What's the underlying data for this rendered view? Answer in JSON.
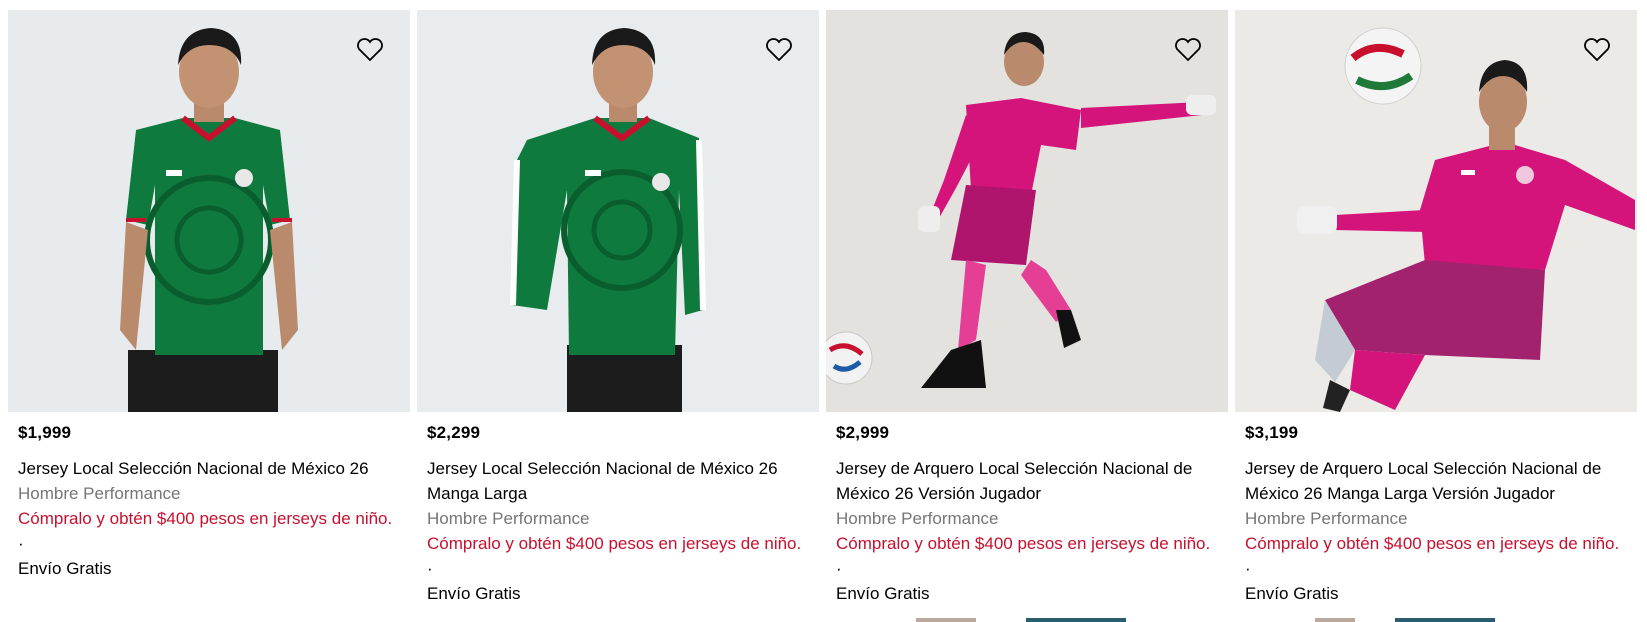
{
  "products": [
    {
      "price": "$1,999",
      "name": "Jersey Local Selección Nacional de México 26",
      "category": "Hombre Performance",
      "promo": "Cómpralo y obtén $400 pesos en jerseys de niño.",
      "separator": "·",
      "shipping": "Envío Gratis"
    },
    {
      "price": "$2,299",
      "name": "Jersey Local Selección Nacional de México 26 Manga Larga",
      "category": "Hombre Performance",
      "promo": "Cómpralo y obtén $400 pesos en jerseys de niño.",
      "separator": "·",
      "shipping": "Envío Gratis"
    },
    {
      "price": "$2,999",
      "name": "Jersey de Arquero Local Selección Nacional de México 26 Versión Jugador",
      "category": "Hombre Performance",
      "promo": "Cómpralo y obtén $400 pesos en jerseys de niño.",
      "separator": "·",
      "shipping": "Envío Gratis"
    },
    {
      "price": "$3,199",
      "name": "Jersey de Arquero Local Selección Nacional de México 26 Manga Larga Versión Jugador",
      "category": "Hombre Performance",
      "promo": "Cómpralo y obtén $400 pesos en jerseys de niño.",
      "separator": "·",
      "shipping": "Envío Gratis"
    }
  ],
  "icons": {
    "wishlist": "heart-outline-icon"
  },
  "colors": {
    "promo": "#c8102e",
    "category": "#767677",
    "image_bg": "#e8ecee",
    "jersey_green": "#0f7a3d",
    "keeper_pink": "#d4147a"
  }
}
